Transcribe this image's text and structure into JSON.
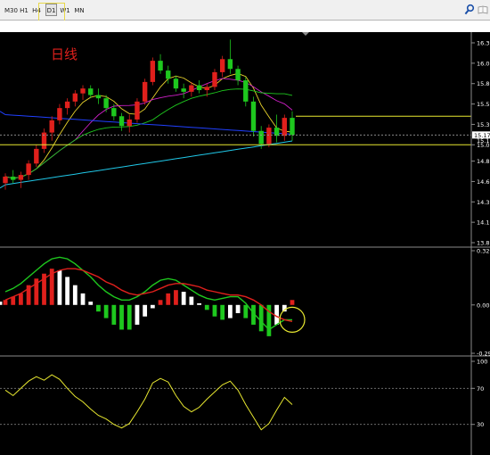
{
  "toolbar": {
    "timeframes": [
      "M30",
      "H1",
      "H4",
      "D1",
      "W1",
      "MN"
    ],
    "active": "D1",
    "search_icon": "search-icon",
    "extra_icon": "book-icon"
  },
  "annotation": {
    "text": "日线",
    "color": "#e0201c"
  },
  "colors": {
    "bg": "#000000",
    "axis_text": "#ffffff",
    "bull": "#e0201c",
    "bear": "#1ec81e",
    "doji": "#ffffff",
    "ma_fast": "#e8d22c",
    "ma_mid": "#d020c8",
    "ma_slow": "#1ec81e",
    "ma_long": "#2040ff",
    "ma_vlong": "#20c8e8",
    "macd_line": "#1ec81e",
    "signal_line": "#e0201c",
    "hline": "#e8e830",
    "circle": "#e8e830",
    "rsi": "#e8e830",
    "price_tag_bg": "#ffffff",
    "price_tag_text": "#000000"
  },
  "chart_data": [
    {
      "type": "candlestick",
      "yticks": [
        "16.30",
        "16.05",
        "15.80",
        "15.55",
        "15.30",
        "15.05",
        "14.85",
        "14.60",
        "14.35",
        "14.10",
        "13.85"
      ],
      "ylim": [
        13.85,
        16.3
      ],
      "current_price": "15.17",
      "price_label_lower": "15.10",
      "horizontal_lines": [
        15.4,
        15.05
      ],
      "candles": [
        {
          "o": 14.58,
          "h": 14.7,
          "l": 14.5,
          "c": 14.66
        },
        {
          "o": 14.66,
          "h": 14.74,
          "l": 14.58,
          "c": 14.62
        },
        {
          "o": 14.62,
          "h": 14.72,
          "l": 14.52,
          "c": 14.68
        },
        {
          "o": 14.68,
          "h": 14.86,
          "l": 14.62,
          "c": 14.82
        },
        {
          "o": 14.82,
          "h": 15.05,
          "l": 14.78,
          "c": 15.0
        },
        {
          "o": 15.0,
          "h": 15.25,
          "l": 14.95,
          "c": 15.2
        },
        {
          "o": 15.2,
          "h": 15.4,
          "l": 15.1,
          "c": 15.35
        },
        {
          "o": 15.35,
          "h": 15.55,
          "l": 15.3,
          "c": 15.5
        },
        {
          "o": 15.5,
          "h": 15.62,
          "l": 15.42,
          "c": 15.58
        },
        {
          "o": 15.58,
          "h": 15.72,
          "l": 15.52,
          "c": 15.68
        },
        {
          "o": 15.68,
          "h": 15.78,
          "l": 15.6,
          "c": 15.74
        },
        {
          "o": 15.74,
          "h": 15.78,
          "l": 15.62,
          "c": 15.66
        },
        {
          "o": 15.66,
          "h": 15.74,
          "l": 15.55,
          "c": 15.62
        },
        {
          "o": 15.62,
          "h": 15.66,
          "l": 15.45,
          "c": 15.5
        },
        {
          "o": 15.5,
          "h": 15.55,
          "l": 15.35,
          "c": 15.4
        },
        {
          "o": 15.4,
          "h": 15.44,
          "l": 15.22,
          "c": 15.28
        },
        {
          "o": 15.28,
          "h": 15.42,
          "l": 15.2,
          "c": 15.36
        },
        {
          "o": 15.36,
          "h": 15.62,
          "l": 15.32,
          "c": 15.58
        },
        {
          "o": 15.58,
          "h": 15.86,
          "l": 15.54,
          "c": 15.82
        },
        {
          "o": 15.82,
          "h": 16.12,
          "l": 15.78,
          "c": 16.08
        },
        {
          "o": 16.08,
          "h": 16.16,
          "l": 15.92,
          "c": 15.96
        },
        {
          "o": 15.96,
          "h": 16.02,
          "l": 15.8,
          "c": 15.86
        },
        {
          "o": 15.86,
          "h": 15.9,
          "l": 15.7,
          "c": 15.74
        },
        {
          "o": 15.74,
          "h": 15.8,
          "l": 15.62,
          "c": 15.7
        },
        {
          "o": 15.7,
          "h": 15.82,
          "l": 15.64,
          "c": 15.78
        },
        {
          "o": 15.78,
          "h": 15.84,
          "l": 15.68,
          "c": 15.72
        },
        {
          "o": 15.72,
          "h": 15.8,
          "l": 15.64,
          "c": 15.76
        },
        {
          "o": 15.76,
          "h": 15.98,
          "l": 15.72,
          "c": 15.94
        },
        {
          "o": 15.94,
          "h": 16.14,
          "l": 15.88,
          "c": 16.1
        },
        {
          "o": 16.1,
          "h": 16.34,
          "l": 15.92,
          "c": 15.98
        },
        {
          "o": 15.98,
          "h": 16.02,
          "l": 15.78,
          "c": 15.84
        },
        {
          "o": 15.84,
          "h": 15.88,
          "l": 15.52,
          "c": 15.58
        },
        {
          "o": 15.58,
          "h": 15.64,
          "l": 15.15,
          "c": 15.22
        },
        {
          "o": 15.22,
          "h": 15.28,
          "l": 15.0,
          "c": 15.06
        },
        {
          "o": 15.06,
          "h": 15.3,
          "l": 15.02,
          "c": 15.26
        },
        {
          "o": 15.26,
          "h": 15.42,
          "l": 15.08,
          "c": 15.16
        },
        {
          "o": 15.16,
          "h": 15.42,
          "l": 15.1,
          "c": 15.38
        },
        {
          "o": 15.38,
          "h": 15.46,
          "l": 15.1,
          "c": 15.17
        }
      ]
    },
    {
      "type": "macd",
      "yticks": [
        "0.3294",
        "0.00",
        "-0.2937"
      ],
      "ylim": [
        -0.2937,
        0.3294
      ],
      "histogram": [
        0.03,
        0.05,
        0.07,
        0.12,
        0.16,
        0.19,
        0.22,
        0.21,
        0.17,
        0.12,
        0.07,
        0.02,
        -0.04,
        -0.08,
        -0.12,
        -0.15,
        -0.15,
        -0.12,
        -0.07,
        -0.02,
        0.03,
        0.07,
        0.09,
        0.08,
        0.05,
        0.01,
        -0.03,
        -0.07,
        -0.09,
        -0.08,
        -0.05,
        -0.08,
        -0.12,
        -0.16,
        -0.19,
        -0.12,
        -0.04,
        0.03,
        0.02
      ],
      "macd": [
        0.08,
        0.1,
        0.13,
        0.17,
        0.21,
        0.25,
        0.28,
        0.29,
        0.28,
        0.25,
        0.21,
        0.17,
        0.12,
        0.08,
        0.05,
        0.03,
        0.03,
        0.05,
        0.08,
        0.12,
        0.15,
        0.16,
        0.15,
        0.12,
        0.09,
        0.06,
        0.04,
        0.03,
        0.04,
        0.05,
        0.05,
        0.01,
        -0.05,
        -0.1,
        -0.15,
        -0.12,
        -0.09,
        -0.09,
        -0.1
      ],
      "signal": [
        0.03,
        0.05,
        0.07,
        0.1,
        0.13,
        0.16,
        0.19,
        0.21,
        0.22,
        0.22,
        0.21,
        0.19,
        0.17,
        0.14,
        0.12,
        0.09,
        0.07,
        0.06,
        0.07,
        0.08,
        0.1,
        0.12,
        0.13,
        0.13,
        0.12,
        0.11,
        0.09,
        0.08,
        0.07,
        0.06,
        0.06,
        0.05,
        0.03,
        0.0,
        -0.04,
        -0.07,
        -0.09,
        -0.1,
        -0.1
      ]
    },
    {
      "type": "line",
      "name": "rsi",
      "yticks": [
        "100",
        "70",
        "30"
      ],
      "ylim": [
        0,
        100
      ],
      "levels": [
        70,
        30
      ],
      "values": [
        68,
        62,
        70,
        78,
        83,
        79,
        85,
        80,
        70,
        61,
        55,
        47,
        40,
        36,
        30,
        26,
        31,
        44,
        58,
        76,
        81,
        77,
        62,
        50,
        44,
        49,
        58,
        66,
        74,
        78,
        68,
        52,
        38,
        24,
        31,
        46,
        60,
        52,
        47
      ]
    }
  ]
}
